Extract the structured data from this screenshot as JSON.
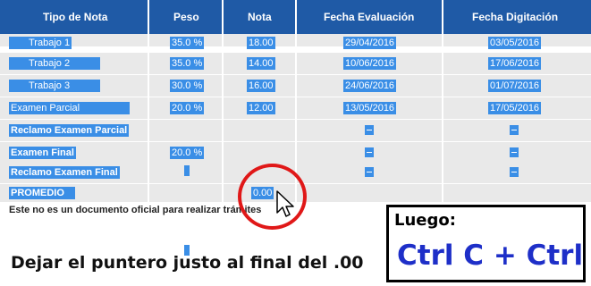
{
  "table": {
    "headers": [
      "Tipo de Nota",
      "Peso",
      "Nota",
      "Fecha Evaluación",
      "Fecha Digitación"
    ],
    "rows": [
      {
        "tipo": "Trabajo 1",
        "peso": "35.0 %",
        "nota": "18.00",
        "fecha_eval": "29/04/2016",
        "fecha_dig": "03/05/2016"
      },
      {
        "tipo": "Trabajo 2",
        "peso": "35.0 %",
        "nota": "14.00",
        "fecha_eval": "10/06/2016",
        "fecha_dig": "17/06/2016"
      },
      {
        "tipo": "Trabajo 3",
        "peso": "30.0 %",
        "nota": "16.00",
        "fecha_eval": "24/06/2016",
        "fecha_dig": "01/07/2016"
      },
      {
        "tipo": "Examen Parcial",
        "peso": "20.0 %",
        "nota": "12.00",
        "fecha_eval": "13/05/2016",
        "fecha_dig": "17/05/2016"
      },
      {
        "tipo": "Reclamo Examen Parcial",
        "peso": "",
        "nota": "",
        "fecha_eval": "",
        "fecha_dig": ""
      },
      {
        "tipo": "Examen Final",
        "peso": "20.0 %",
        "nota": "",
        "fecha_eval": "",
        "fecha_dig": ""
      },
      {
        "tipo": "Reclamo Examen Final",
        "peso": "",
        "nota": "",
        "fecha_eval": "",
        "fecha_dig": ""
      },
      {
        "tipo": "PROMEDIO",
        "peso": "",
        "nota": "0.00",
        "fecha_eval": "",
        "fecha_dig": ""
      }
    ]
  },
  "note": "Este no es un documento oficial para realizar trámites",
  "instruction": "Dejar el puntero justo al final del .00",
  "callout": {
    "title": "Luego:",
    "shortcut": "Ctrl C + Ctrl V"
  }
}
